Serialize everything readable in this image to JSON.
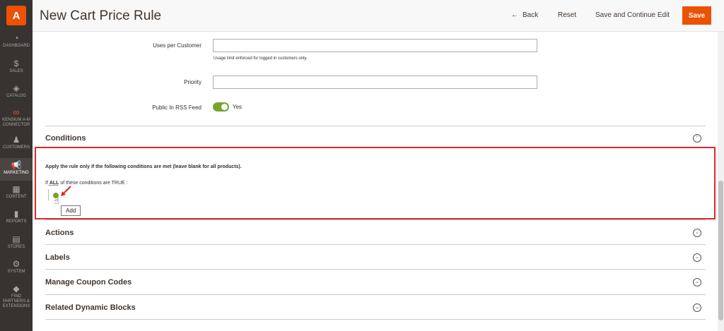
{
  "app": {
    "logo_letter": "A",
    "accent": "#eb5202"
  },
  "sidebar": {
    "items": [
      {
        "label": "DASHBOARD",
        "icon": "dashboard-icon",
        "glyph": "◔"
      },
      {
        "label": "SALES",
        "icon": "dollar-icon",
        "glyph": "$"
      },
      {
        "label": "CATALOG",
        "icon": "cube-icon",
        "glyph": "◈"
      },
      {
        "label": "KENSIUM A-M CONNECTOR",
        "icon": "connector-icon",
        "glyph": "∞"
      },
      {
        "label": "CUSTOMERS",
        "icon": "person-icon",
        "glyph": "♟"
      },
      {
        "label": "MARKETING",
        "icon": "megaphone-icon",
        "glyph": "📢"
      },
      {
        "label": "CONTENT",
        "icon": "content-icon",
        "glyph": "▦"
      },
      {
        "label": "REPORTS",
        "icon": "bar-chart-icon",
        "glyph": "▮"
      },
      {
        "label": "STORES",
        "icon": "store-icon",
        "glyph": "▤"
      },
      {
        "label": "SYSTEM",
        "icon": "gear-icon",
        "glyph": "⚙"
      },
      {
        "label": "FIND PARTNERS & EXTENSIONS",
        "icon": "box-icon",
        "glyph": "◆"
      }
    ]
  },
  "header": {
    "title": "New Cart Price Rule",
    "back_label": "Back",
    "reset_label": "Reset",
    "save_continue_label": "Save and Continue Edit",
    "save_label": "Save"
  },
  "form": {
    "uses_per_customer_label": "Uses per Customer",
    "uses_per_customer_value": "",
    "uses_note": "Usage limit enforced for logged in customers only.",
    "priority_label": "Priority",
    "priority_value": "",
    "rss_label": "Public In RSS Feed",
    "rss_value": "Yes"
  },
  "conditions": {
    "title": "Conditions",
    "apply_text": "Apply the rule only if the following conditions are met (leave blank for all products).",
    "if_prefix": "If",
    "aggregator": "ALL",
    "if_suffix": "of these conditions are TRUE :",
    "tooltip": "Add"
  },
  "sections": [
    {
      "title": "Actions"
    },
    {
      "title": "Labels"
    },
    {
      "title": "Manage Coupon Codes"
    },
    {
      "title": "Related Dynamic Blocks"
    }
  ]
}
